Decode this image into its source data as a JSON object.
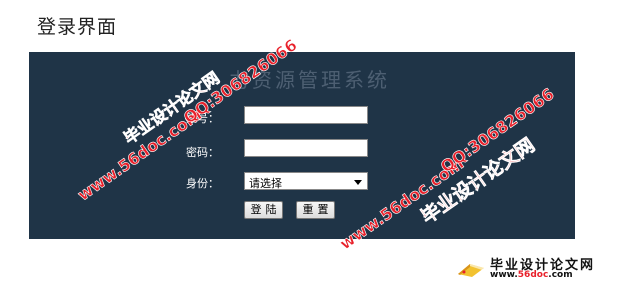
{
  "page": {
    "heading": "登录界面"
  },
  "login": {
    "system_title": "力资源管理系统",
    "account_label": "账号：",
    "account_value": "",
    "password_label": "密码：",
    "password_value": "",
    "role_label": "身份：",
    "role_selected": "请选择",
    "login_button": "登陆",
    "reset_button": "重置"
  },
  "watermarks": {
    "brand": "毕业设计论文网",
    "site": "www.56doc.com",
    "qq": "QQ:306826066"
  },
  "footer_logo": {
    "title": "毕业设计论文网",
    "sub_prefix": "www.",
    "sub_accent": "56doc",
    "sub_suffix": ".com"
  },
  "colors": {
    "panel": "#1f3447",
    "watermark": "#e8202a"
  }
}
